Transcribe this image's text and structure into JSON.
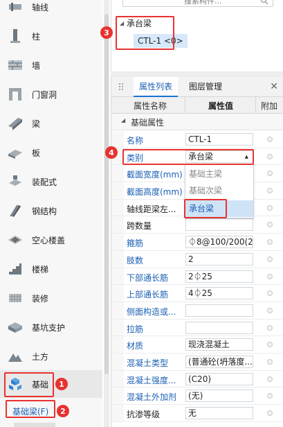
{
  "nav": {
    "items": [
      {
        "label": "轴线",
        "icon": "axis-icon"
      },
      {
        "label": "柱",
        "icon": "column-icon"
      },
      {
        "label": "墙",
        "icon": "wall-icon"
      },
      {
        "label": "门窗洞",
        "icon": "door-window-icon"
      },
      {
        "label": "梁",
        "icon": "beam-icon"
      },
      {
        "label": "板",
        "icon": "slab-icon"
      },
      {
        "label": "装配式",
        "icon": "prefab-icon"
      },
      {
        "label": "钢结构",
        "icon": "steel-icon"
      },
      {
        "label": "空心楼盖",
        "icon": "hollow-floor-icon"
      },
      {
        "label": "楼梯",
        "icon": "stairs-icon"
      },
      {
        "label": "装修",
        "icon": "decoration-icon"
      },
      {
        "label": "基坑支护",
        "icon": "pit-support-icon"
      },
      {
        "label": "土方",
        "icon": "earthwork-icon"
      },
      {
        "label": "基础",
        "icon": "foundation-icon"
      }
    ],
    "sub_item": "基础梁(F)"
  },
  "tree": {
    "search_placeholder": "搜索构件...",
    "group": "承台梁",
    "leaf": "CTL-1 <0>"
  },
  "props": {
    "tabs": [
      "属性列表",
      "图层管理"
    ],
    "headers": {
      "name": "属性名称",
      "value": "属性值",
      "extra": "附加"
    },
    "section": "基础属性",
    "rows": [
      {
        "name": "名称",
        "value": "CTL-1",
        "color": "blue"
      },
      {
        "name": "类别",
        "value": "承台梁",
        "color": "blue"
      },
      {
        "name": "截面宽度(mm)",
        "value": "",
        "color": "blue"
      },
      {
        "name": "截面高度(mm)",
        "value": "",
        "color": "blue"
      },
      {
        "name": "轴线距梁左...",
        "value": "",
        "color": "black"
      },
      {
        "name": "跨数量",
        "value": "",
        "color": "black"
      },
      {
        "name": "箍筋",
        "value": "⏀8@100/200(2)",
        "color": "blue"
      },
      {
        "name": "肢数",
        "value": "2",
        "color": "blue"
      },
      {
        "name": "下部通长筋",
        "value": "2⏀25",
        "color": "blue"
      },
      {
        "name": "上部通长筋",
        "value": "4⏀25",
        "color": "blue"
      },
      {
        "name": "侧面构造或...",
        "value": "",
        "color": "blue"
      },
      {
        "name": "拉筋",
        "value": "",
        "color": "blue"
      },
      {
        "name": "材质",
        "value": "现浇混凝土",
        "color": "blue"
      },
      {
        "name": "混凝土类型",
        "value": "(普通砼(坍落度...",
        "color": "blue"
      },
      {
        "name": "混凝土强度...",
        "value": "(C20)",
        "color": "blue"
      },
      {
        "name": "混凝土外加剂",
        "value": "(无)",
        "color": "blue"
      },
      {
        "name": "抗渗等级",
        "value": "无",
        "color": "black"
      }
    ],
    "dropdown_options": [
      "基础主梁",
      "基础次梁",
      "承台梁"
    ]
  },
  "annotations": [
    "1",
    "2",
    "3",
    "4"
  ],
  "colors": {
    "highlight": "#e8322f",
    "accent": "#1a5fb4"
  }
}
